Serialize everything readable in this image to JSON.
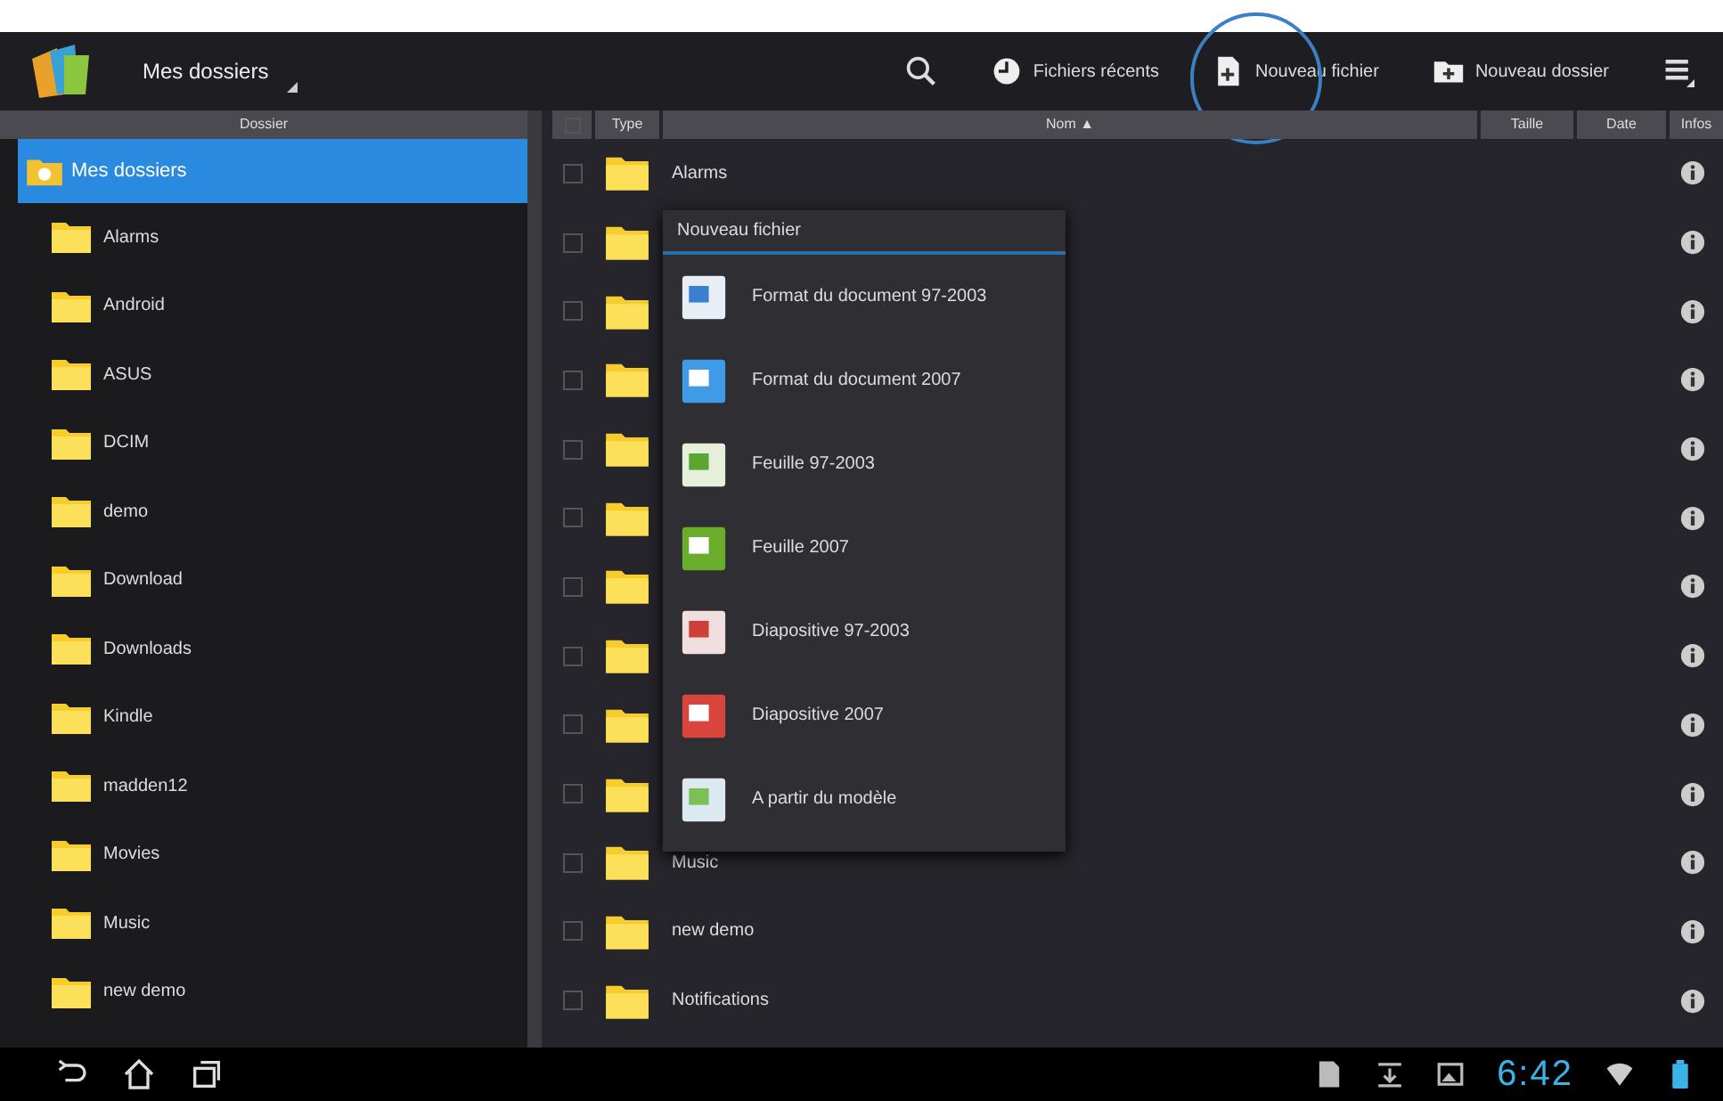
{
  "app_bar": {
    "title": "Mes dossiers",
    "actions": [
      {
        "kind": "search"
      },
      {
        "kind": "recent",
        "label": "Fichiers récents"
      },
      {
        "kind": "newfile",
        "label": "Nouveau fichier",
        "highlighted": true
      },
      {
        "kind": "newfolder",
        "label": "Nouveau dossier"
      },
      {
        "kind": "menu"
      }
    ]
  },
  "sidebar": {
    "heading": "Dossier",
    "root": {
      "label": "Mes dossiers",
      "selected": true
    },
    "items": [
      {
        "label": "Alarms",
        "selected": false
      },
      {
        "label": "Android",
        "selected": false
      },
      {
        "label": "ASUS",
        "selected": false
      },
      {
        "label": "DCIM",
        "selected": false
      },
      {
        "label": "demo",
        "selected": false
      },
      {
        "label": "Download",
        "selected": false
      },
      {
        "label": "Downloads",
        "selected": false
      },
      {
        "label": "Kindle",
        "selected": false
      },
      {
        "label": "madden12",
        "selected": false
      },
      {
        "label": "Movies",
        "selected": false
      },
      {
        "label": "Music",
        "selected": false
      },
      {
        "label": "new demo",
        "selected": false
      }
    ]
  },
  "table": {
    "select_all": {
      "checked": false
    },
    "columns": [
      "Type",
      "Nom ▲",
      "Taille",
      "Date",
      "Infos"
    ],
    "rows": [
      {
        "name": "Alarms",
        "checked": false
      },
      {
        "checked": false
      },
      {
        "checked": false
      },
      {
        "checked": false
      },
      {
        "checked": false
      },
      {
        "checked": false
      },
      {
        "checked": false
      },
      {
        "checked": false
      },
      {
        "checked": false
      },
      {
        "checked": false
      },
      {
        "name": "Music",
        "checked": false
      },
      {
        "name": "new demo",
        "checked": false
      },
      {
        "name": "Notifications",
        "checked": false
      }
    ]
  },
  "popup_menu": {
    "title": "Nouveau fichier",
    "items": [
      {
        "kind": "doc",
        "label": "Format du document 97-2003"
      },
      {
        "kind": "docx",
        "label": "Format du document 2007"
      },
      {
        "kind": "xls",
        "label": "Feuille 97-2003"
      },
      {
        "kind": "xlsx",
        "label": "Feuille 2007"
      },
      {
        "kind": "ppt",
        "label": "Diapositive 97-2003"
      },
      {
        "kind": "pptx",
        "label": "Diapositive 2007"
      },
      {
        "kind": "template",
        "label": "A partir du modèle"
      }
    ]
  },
  "nav_bar": {
    "time": "6:42"
  }
}
